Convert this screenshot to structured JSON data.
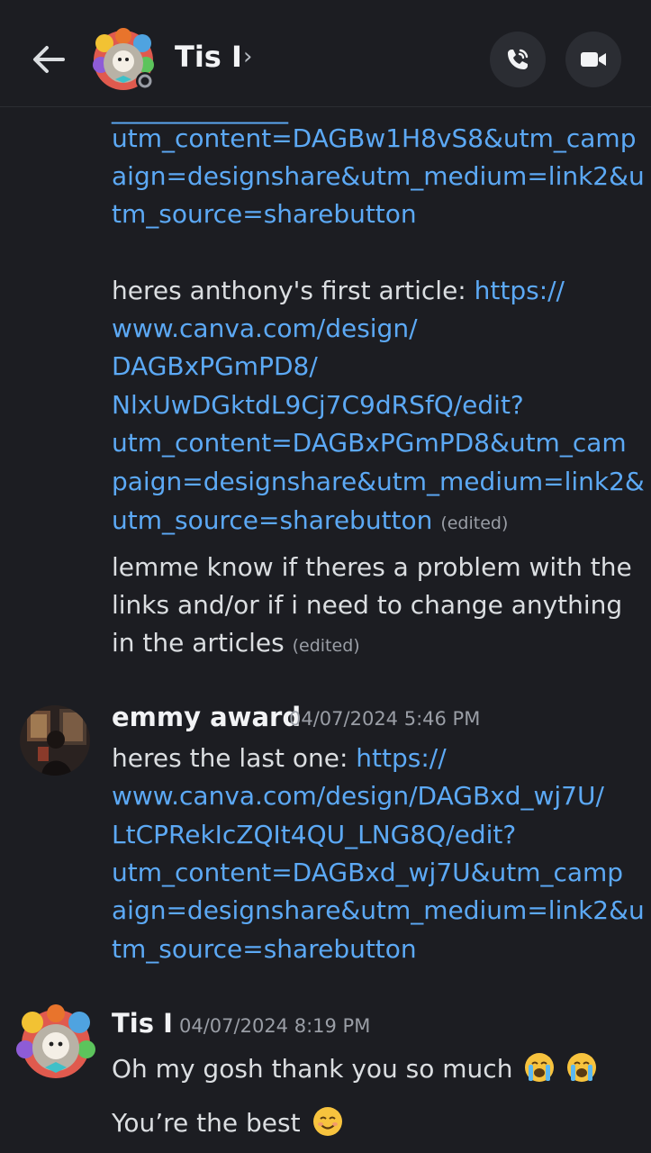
{
  "header": {
    "contact_name": "Tis I",
    "chevron": "›",
    "back_icon": "arrow-left-icon",
    "call_icon": "phone-call-icon",
    "video_icon": "video-camera-icon"
  },
  "messages": {
    "m1": {
      "lines": [
        "utm_content=DAGBw1H8vS8&utm_camp",
        "aign=designshare&utm_medium=link2&u",
        "tm_source=sharebutton"
      ]
    },
    "m2": {
      "prefix": "heres anthony's first article: ",
      "link_first": "https://",
      "lines": [
        "www.canva.com/design/",
        "DAGBxPGmPD8/",
        "NlxUwDGktdL9Cj7C9dRSfQ/edit?",
        "utm_content=DAGBxPGmPD8&utm_cam",
        "paign=designshare&utm_medium=link2&",
        "utm_source=sharebutton"
      ],
      "edited": "(edited)"
    },
    "m3": {
      "lines": [
        "lemme know if theres a problem with the",
        "links and/or if i need to change anything",
        "in the articles"
      ],
      "edited": "(edited)"
    },
    "m4": {
      "author": "emmy award",
      "timestamp": "04/07/2024 5:46 PM",
      "prefix": "heres the last one: ",
      "link_first": "https://",
      "lines": [
        "www.canva.com/design/DAGBxd_wj7U/",
        "LtCPRekIcZQIt4QU_LNG8Q/edit?",
        "utm_content=DAGBxd_wj7U&utm_camp",
        "aign=designshare&utm_medium=link2&u",
        "tm_source=sharebutton"
      ]
    },
    "m5": {
      "author": "Tis I",
      "timestamp": "04/07/2024 8:19 PM",
      "line1": "Oh my gosh thank you so much",
      "line2": "You’re the best",
      "emoji1": "loudly-crying-face",
      "emoji2": "smiling-face"
    }
  },
  "colors": {
    "background": "#1c1d22",
    "link": "#5ca9f5",
    "text": "#dbdee1",
    "muted": "#9a9ea6"
  }
}
